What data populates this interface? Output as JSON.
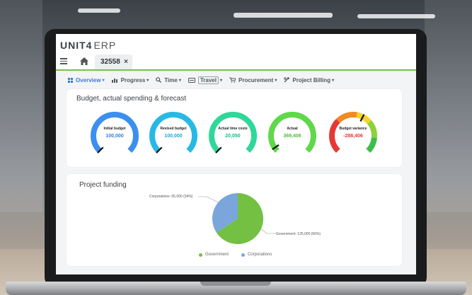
{
  "app": {
    "brand": "UNIT4",
    "product": "ERP"
  },
  "tab": {
    "label": "32558",
    "close": "×"
  },
  "menu": [
    {
      "label": "Overview",
      "icon": "grid-icon",
      "active": true
    },
    {
      "label": "Progress",
      "icon": "bar-chart-icon"
    },
    {
      "label": "Time",
      "icon": "search-icon"
    },
    {
      "label": "Travel",
      "icon": "travel-icon",
      "boxed": true
    },
    {
      "label": "Procurement",
      "icon": "cart-icon"
    },
    {
      "label": "Project Billing",
      "icon": "billing-icon"
    }
  ],
  "budget_card": {
    "title": "Budget, actual spending & forecast",
    "gauges": [
      {
        "label": "Initial budget",
        "value": "100,000",
        "color": "#3b8ff0",
        "value_color": "#2f7fd8",
        "level": 0.0
      },
      {
        "label": "Revised budget",
        "value": "100,000",
        "color": "#27b9e6",
        "value_color": "#1aa8d4",
        "level": 0.0
      },
      {
        "label": "Actual time costs",
        "value": "20,050",
        "color": "#2fd89a",
        "value_color": "#1fb880",
        "level": 0.0
      },
      {
        "label": "Actual",
        "value": "369,406",
        "color": "#5fd84a",
        "value_color": "#48c23a",
        "level": 0.04
      },
      {
        "label": "Budget variance",
        "value": "-288,406",
        "color": "#e53935",
        "value_color": "#e53935",
        "level": 0.6,
        "gradient": true
      }
    ]
  },
  "funding_card": {
    "title": "Project funding",
    "chart_data": {
      "type": "pie",
      "slices": [
        {
          "name": "Government",
          "value": 125000,
          "percent": 66,
          "label": "Government: 125,000 (66%)",
          "color": "#74c043"
        },
        {
          "name": "Corporations",
          "value": 65000,
          "percent": 34,
          "label": "Corporations: 65,000 (34%)",
          "color": "#7aa6dc"
        }
      ],
      "legend": [
        "Government",
        "Corporations"
      ],
      "legend_position": "bottom"
    }
  }
}
